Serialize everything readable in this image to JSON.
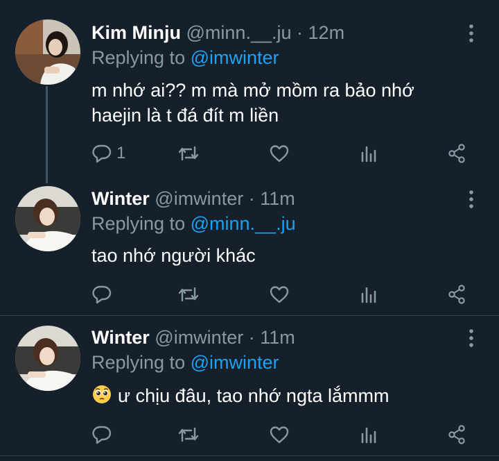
{
  "tweets": [
    {
      "name": "Kim Minju",
      "handle": "@minn.__.ju",
      "dot": "·",
      "time": "12m",
      "replying_prefix": "Replying to",
      "replying_to": "@imwinter",
      "text_line1": "m nhớ ai?? m mà mở mồm ra bảo nhớ",
      "text_line2": "haejin là t đá đít m liền",
      "reply_count": "1"
    },
    {
      "name": "Winter",
      "handle": "@imwinter",
      "dot": "·",
      "time": "11m",
      "replying_prefix": "Replying to",
      "replying_to": "@minn.__.ju",
      "text_line1": "tao nhớ người khác"
    },
    {
      "name": "Winter",
      "handle": "@imwinter",
      "dot": "·",
      "time": "11m",
      "replying_prefix": "Replying to",
      "replying_to": "@imwinter",
      "emoji": "pleading-face",
      "text_line1": "ư chịu đâu, tao nhớ ngta lắmmm"
    }
  ],
  "icons": [
    "reply-icon",
    "retweet-icon",
    "like-icon",
    "analytics-icon",
    "share-icon",
    "more-icon"
  ],
  "colors": {
    "background": "#15202b",
    "mention": "#1da1f2",
    "muted": "#8899a6",
    "divider": "#38444d"
  }
}
